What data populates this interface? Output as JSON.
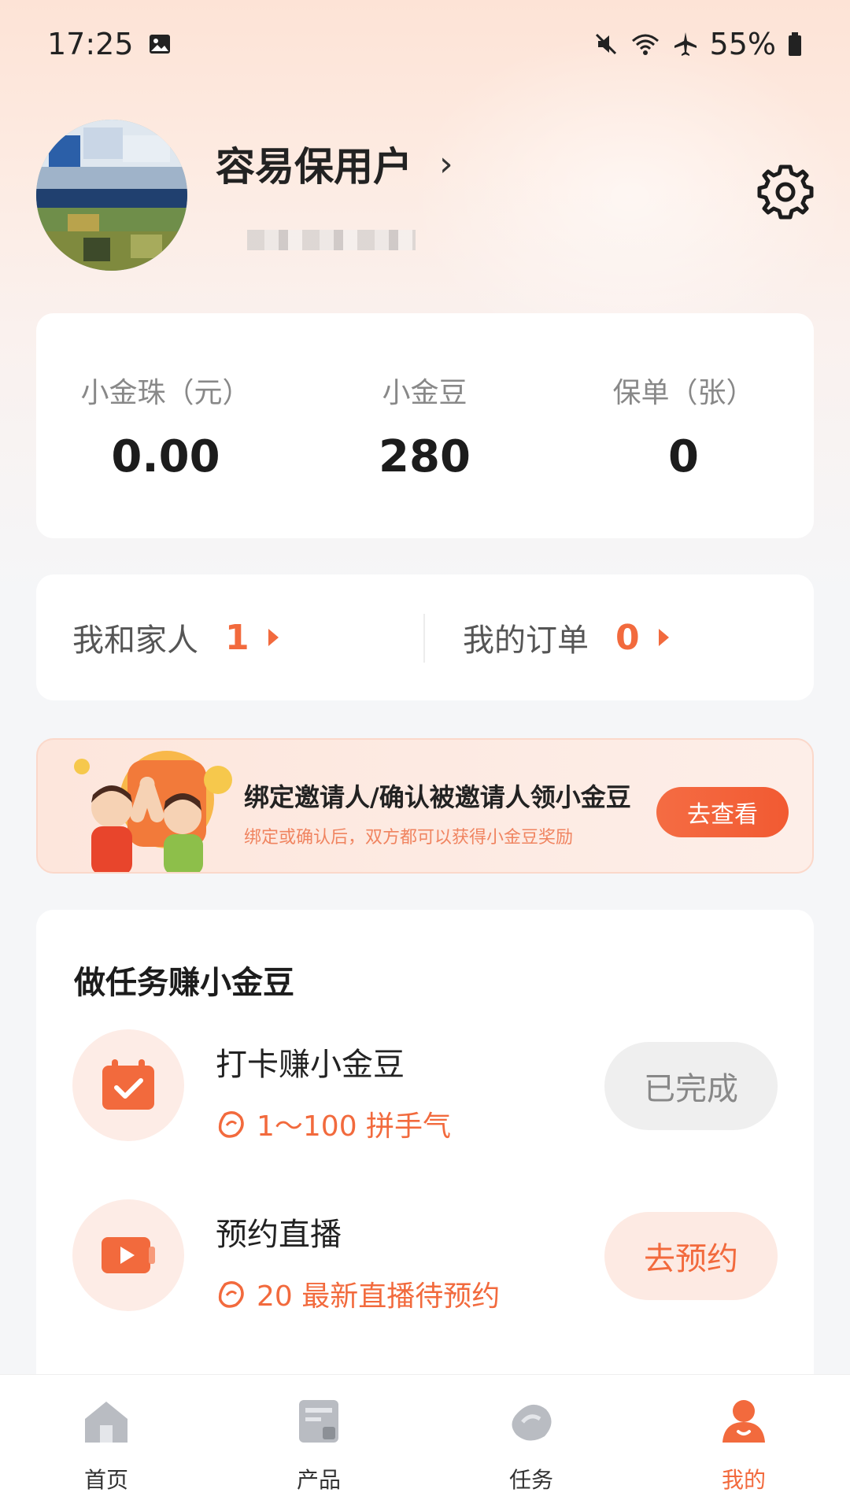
{
  "status_bar": {
    "time": "17:25",
    "battery": "55%"
  },
  "profile": {
    "name": "容易保用户",
    "chevron": "›"
  },
  "stats": [
    {
      "label": "小金珠（元）",
      "value": "0.00"
    },
    {
      "label": "小金豆",
      "value": "280"
    },
    {
      "label": "保单（张）",
      "value": "0"
    }
  ],
  "links": [
    {
      "label": "我和家人",
      "count": "1"
    },
    {
      "label": "我的订单",
      "count": "0"
    }
  ],
  "banner": {
    "title": "绑定邀请人/确认被邀请人领小金豆",
    "subtitle": "绑定或确认后，双方都可以获得小金豆奖励",
    "button": "去查看"
  },
  "tasks": {
    "heading": "做任务赚小金豆",
    "items": [
      {
        "name": "打卡赚小金豆",
        "reward": "1～100 拼手气",
        "button": "已完成"
      },
      {
        "name": "预约直播",
        "reward": "20 最新直播待预约",
        "button": "去预约"
      }
    ]
  },
  "tabbar": [
    {
      "label": "首页",
      "icon": "home-icon"
    },
    {
      "label": "产品",
      "icon": "product-icon"
    },
    {
      "label": "任务",
      "icon": "task-icon"
    },
    {
      "label": "我的",
      "icon": "user-icon"
    }
  ],
  "colors": {
    "accent": "#f26a3d",
    "background": "#f5f6f8"
  }
}
